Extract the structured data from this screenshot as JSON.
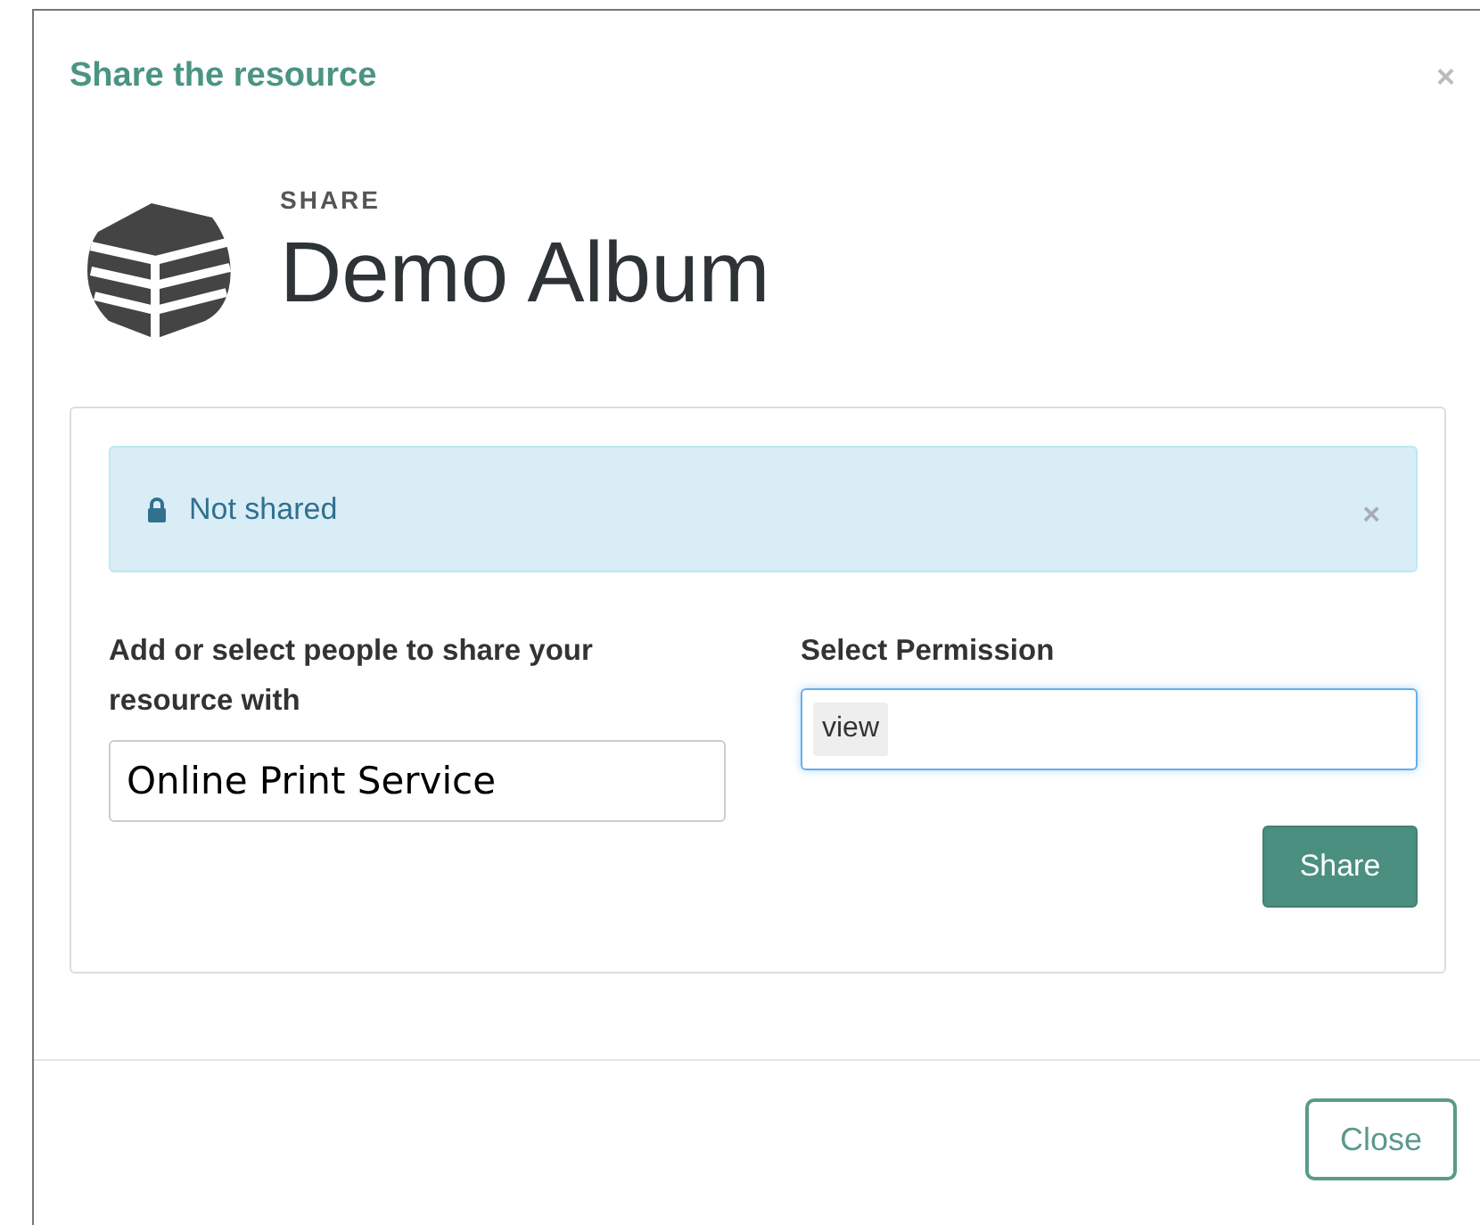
{
  "dialog": {
    "title": "Share the resource",
    "close_glyph": "×"
  },
  "resource": {
    "label": "SHARE",
    "name": "Demo Album"
  },
  "alert": {
    "text": "Not shared",
    "dismiss_glyph": "×"
  },
  "people": {
    "label": "Add or select people to share your resource with",
    "value": "Online Print Service"
  },
  "permission": {
    "label": "Select Permission",
    "tags": [
      "view"
    ],
    "focused": true
  },
  "share_button": "Share",
  "footer_buttons": [
    "Close"
  ]
}
